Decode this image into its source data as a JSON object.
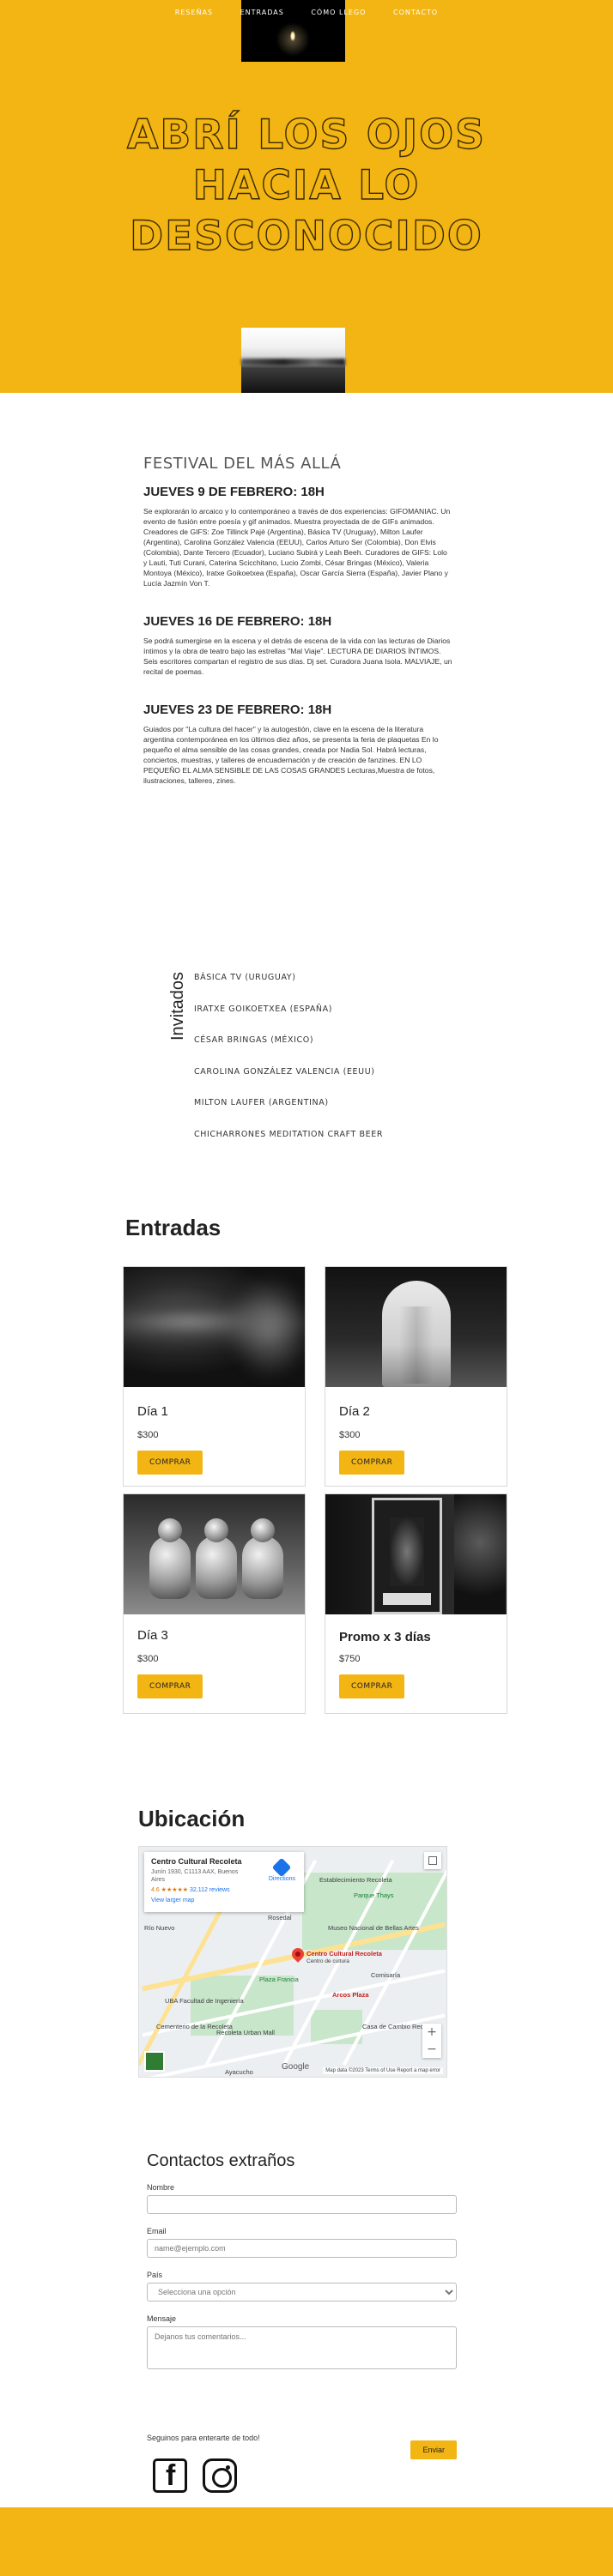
{
  "nav": {
    "items": [
      "RESEÑAS",
      "ENTRADAS",
      "CÓMO LLEGO",
      "CONTACTO"
    ]
  },
  "hero": {
    "title_line1": "ABRÍ LOS OJOS",
    "title_line2": "HACIA LO",
    "title_line3": "DESCONOCIDO"
  },
  "festival": {
    "title": "FESTIVAL DEL MÁS ALLÁ",
    "days": [
      {
        "heading": "JUEVES 9 DE FEBRERO: 18H",
        "text": "Se explorarán lo arcaico y lo contemporáneo a través de dos experiencias: GIFOMANIAC. Un evento de fusión entre poesía y gif animados. Muestra proyectada de de GIFs animados. Creadores de GIFS: Zoe Tillinck Pajé (Argentina), Básica TV (Uruguay), Milton Laufer (Argentina), Carolina González Valencia (EEUU), Carlos Arturo Ser (Colombia), Don Elvis (Colombia), Dante Tercero (Ecuador), Luciano Subirá y Leah Beeh. Curadores de GIFS: Lolo y Lauti, Tuti Curani, Caterina Scicchitano, Lucio Zombi, César Bringas (México), Valeria Montoya (México), Iratxe Goikoetxea (España), Oscar García Sierra (España), Javier Plano y Lucía Jazmín Von T."
      },
      {
        "heading": "JUEVES 16 DE FEBRERO: 18H",
        "text": "Se podrá sumergirse en la escena y el detrás de escena de la vida con las lecturas de Diarios íntimos y la obra de teatro bajo las estrellas \"Mal Viaje\". LECTURA DE DIARIOS ÍNTIMOS. Seis escritores compartan el registro de sus días. Dj set. Curadora Juana Isola. MALVIAJE, un recital de poemas."
      },
      {
        "heading": "JUEVES 23 DE FEBRERO: 18H",
        "text": "Guiados por \"La cultura del hacer\" y la autogestión, clave en la escena de la literatura argentina contemporánea en los últimos diez años, se presenta la feria de plaquetas En lo pequeño el alma sensible de las cosas grandes, creada por Nadia Sol. Habrá lecturas, conciertos, muestras, y talleres de encuadernación y de creación de fanzines. EN LO PEQUEÑO EL ALMA SENSIBLE DE LAS COSAS GRANDES Lecturas,Muestra de fotos, ilustraciones, talleres, zines."
      }
    ]
  },
  "invitados": {
    "title": "Invitados",
    "items": [
      "BÁSICA TV (URUGUAY)",
      "IRATXE GOIKOETXEA (ESPAÑA)",
      "CÉSAR BRINGAS (MÉXICO)",
      "CAROLINA GONZÁLEZ VALENCIA (EEUU)",
      "MILTON LAUFER (ARGENTINA)",
      "CHICHARRONES MEDITATION CRAFT BEER"
    ]
  },
  "entradas": {
    "title": "Entradas",
    "tickets": [
      {
        "name": "Día 1",
        "price": "$300",
        "button": "COMPRAR"
      },
      {
        "name": "Día 2",
        "price": "$300",
        "button": "COMPRAR"
      },
      {
        "name": "Día 3",
        "price": "$300",
        "button": "COMPRAR"
      },
      {
        "name": "Promo x 3 días",
        "price": "$750",
        "button": "COMPRAR"
      }
    ]
  },
  "ubicacion": {
    "title": "Ubicación",
    "place_name": "Centro Cultural Recoleta",
    "address": "Junín 1930, C1113 AAX, Buenos Aires",
    "rating": "4.6 ★★★★★",
    "reviews": "32,112 reviews",
    "larger_map": "View larger map",
    "directions": "Directions",
    "labels": {
      "pin": "Centro Cultural Recoleta",
      "pin_sub": "Centro de cultura",
      "lake": "Parque Thays",
      "museum": "Museo Nacional de Bellas Artes",
      "plaza": "Plaza Francia",
      "cementerio": "Cementerio de la Recoleta",
      "facultad": "UBA Facultad de Ingeniería",
      "buenos": "Buenos Aires Design",
      "shopping": "Recoleta Urban Mall",
      "casa": "Casa de Cambio Recoleta",
      "ayacucho": "Ayacucho",
      "establecimiento": "Establecimiento Recoleta",
      "rio": "Río Nuevo",
      "rosa": "Rosedal",
      "arcos": "Arcos Plaza",
      "comisaria": "Comisaría"
    },
    "google": "Google",
    "footer_text": "Map data ©2023   Terms of Use   Report a map error"
  },
  "contact": {
    "title": "Contactos extraños",
    "name_label": "Nombre",
    "name_value": "",
    "email_label": "Email",
    "email_placeholder": "name@ejemplo.com",
    "country_label": "País",
    "country_selected": "Selecciona una opción",
    "message_label": "Mensaje",
    "message_placeholder": "Dejanos tus comentarios...",
    "send": "Enviar",
    "follow": "Seguinos para enterarte de todo!"
  },
  "colors": {
    "accent": "#f3b513"
  },
  "icons": {
    "facebook": "facebook-icon",
    "instagram": "instagram-icon"
  }
}
